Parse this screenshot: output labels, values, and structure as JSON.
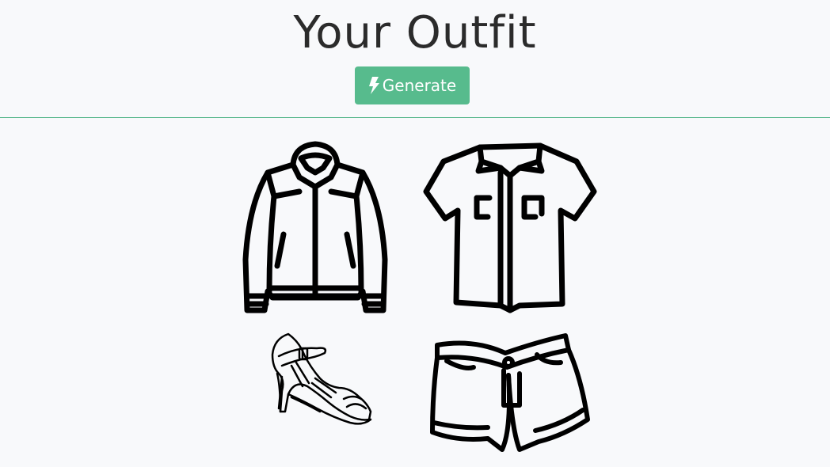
{
  "header": {
    "title": "Your Outfit",
    "generate_label": "Generate",
    "generate_icon": "bolt-icon"
  },
  "outfit": {
    "items": [
      {
        "name": "jacket",
        "icon": "jacket-icon"
      },
      {
        "name": "shirt",
        "icon": "shirt-icon"
      },
      {
        "name": "shoe",
        "icon": "high-heel-sandal-icon"
      },
      {
        "name": "shorts",
        "icon": "shorts-icon"
      }
    ]
  },
  "colors": {
    "accent": "#57bb8d",
    "divider": "#5bb98e",
    "background": "#f8f9fb",
    "title": "#2b2b2b"
  }
}
